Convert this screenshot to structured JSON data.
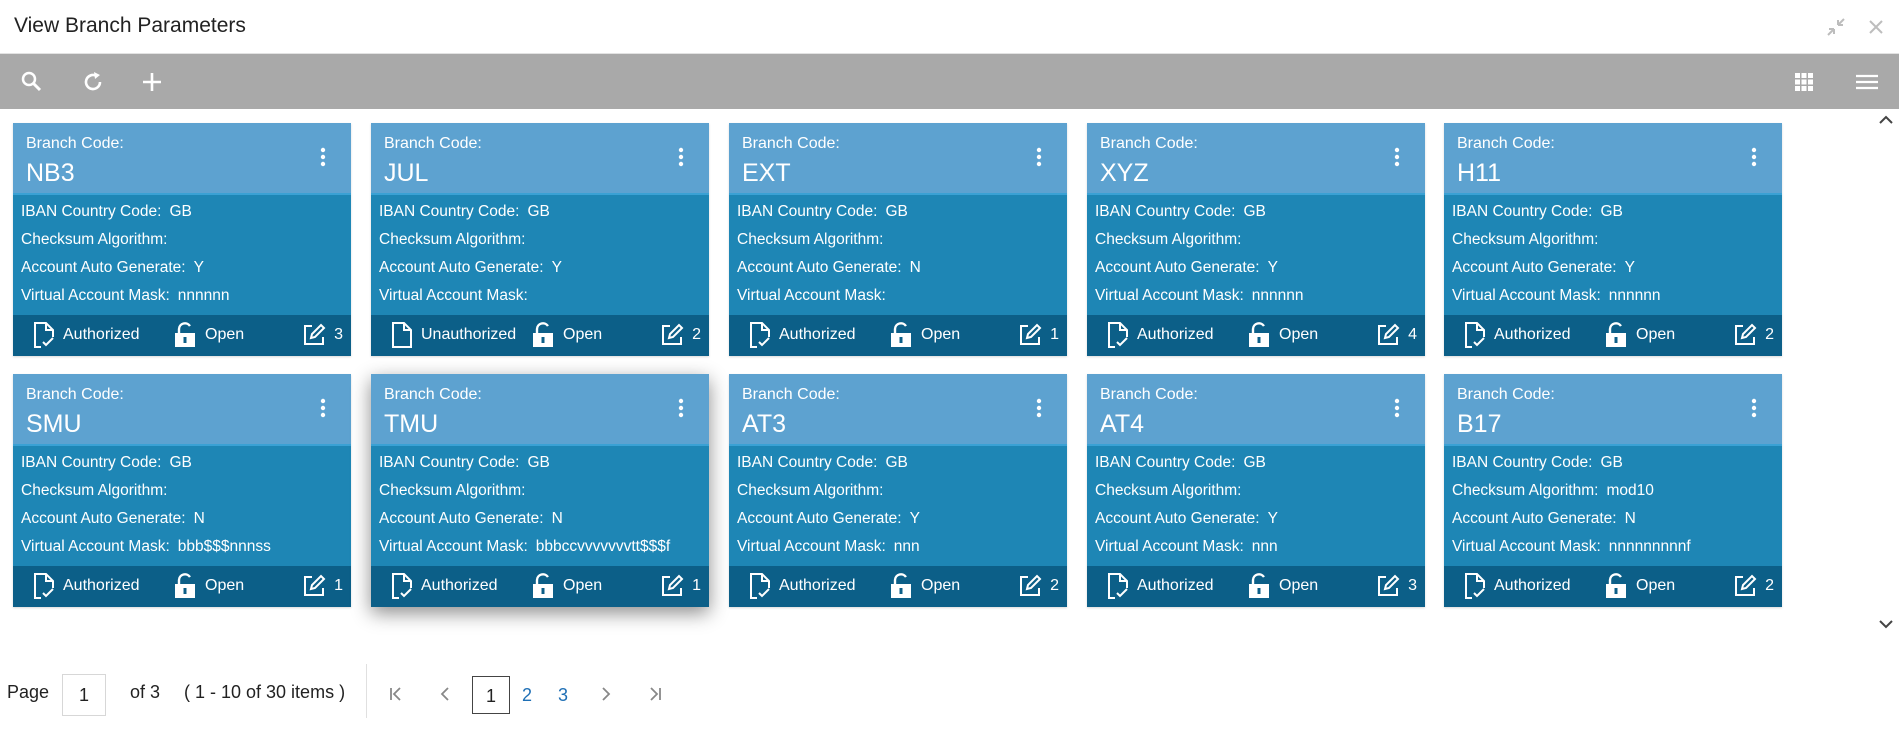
{
  "window": {
    "title": "View Branch Parameters"
  },
  "toolbar": {
    "search": "search-icon",
    "refresh": "refresh-icon",
    "add": "plus-icon",
    "grid_view": "grid-icon",
    "list_view": "menu-icon"
  },
  "labels": {
    "branch_code": "Branch Code:",
    "iban": "IBAN Country Code:",
    "checksum": "Checksum Algorithm:",
    "auto_gen": "Account Auto Generate:",
    "mask": "Virtual Account Mask:",
    "open": "Open"
  },
  "cards": [
    {
      "code": "NB3",
      "iban": "GB",
      "checksum": "",
      "auto": "Y",
      "mask": "nnnnnn",
      "status": "Authorized",
      "edits": "3"
    },
    {
      "code": "JUL",
      "iban": "GB",
      "checksum": "",
      "auto": "Y",
      "mask": "",
      "status": "Unauthorized",
      "edits": "2"
    },
    {
      "code": "EXT",
      "iban": "GB",
      "checksum": "",
      "auto": "N",
      "mask": "",
      "status": "Authorized",
      "edits": "1"
    },
    {
      "code": "XYZ",
      "iban": "GB",
      "checksum": "",
      "auto": "Y",
      "mask": "nnnnnn",
      "status": "Authorized",
      "edits": "4"
    },
    {
      "code": "H11",
      "iban": "GB",
      "checksum": "",
      "auto": "Y",
      "mask": "nnnnnn",
      "status": "Authorized",
      "edits": "2"
    },
    {
      "code": "SMU",
      "iban": "GB",
      "checksum": "",
      "auto": "N",
      "mask": "bbb$$$nnnss",
      "status": "Authorized",
      "edits": "1"
    },
    {
      "code": "TMU",
      "iban": "GB",
      "checksum": "",
      "auto": "N",
      "mask": "bbbccvvvvvvvtt$$$f",
      "status": "Authorized",
      "edits": "1"
    },
    {
      "code": "AT3",
      "iban": "GB",
      "checksum": "",
      "auto": "Y",
      "mask": "nnn",
      "status": "Authorized",
      "edits": "2"
    },
    {
      "code": "AT4",
      "iban": "GB",
      "checksum": "",
      "auto": "Y",
      "mask": "nnn",
      "status": "Authorized",
      "edits": "3"
    },
    {
      "code": "B17",
      "iban": "GB",
      "checksum": "mod10",
      "auto": "N",
      "mask": "nnnnnnnnnf",
      "status": "Authorized",
      "edits": "2"
    }
  ],
  "pagination": {
    "page_label": "Page",
    "current_page": "1",
    "of_label": "of 3",
    "range_label": "( 1 - 10 of 30 items )",
    "pages": [
      "1",
      "2",
      "3"
    ]
  },
  "colors": {
    "header": "#5da2d0",
    "body": "#1e86b5",
    "footer": "#0c5f88",
    "toolbar": "#a9a9a9",
    "link": "#1e6fb5"
  }
}
